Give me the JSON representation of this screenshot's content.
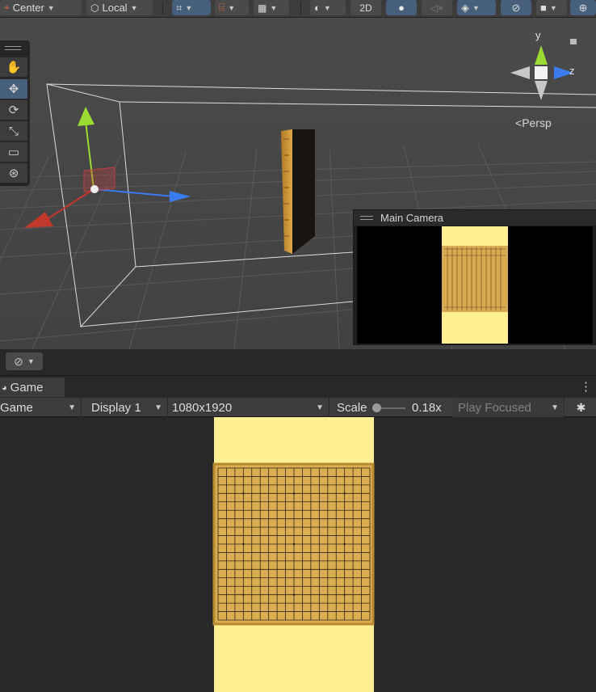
{
  "toolbar": {
    "pivot_label": "Center",
    "space_label": "Local",
    "mode_2d_label": "2D"
  },
  "scene": {
    "tools": [
      "hand-tool",
      "move-tool",
      "rotate-tool",
      "scale-tool",
      "rect-tool",
      "transform-tool"
    ],
    "axis_y": "y",
    "axis_z": "z",
    "persp_label": "Persp",
    "camera_preview_title": "Main Camera"
  },
  "game": {
    "tab_label": "Game",
    "view_select": "Game",
    "display_select": "Display 1",
    "resolution_select": "1080x1920",
    "scale_label": "Scale",
    "scale_value": "0.18x",
    "scale_fraction": 0.05,
    "play_mode_select": "Play Focused"
  },
  "colors": {
    "accent_blue": "#46607c",
    "board_wood": "#dcae52",
    "board_bg": "#ffef93"
  }
}
